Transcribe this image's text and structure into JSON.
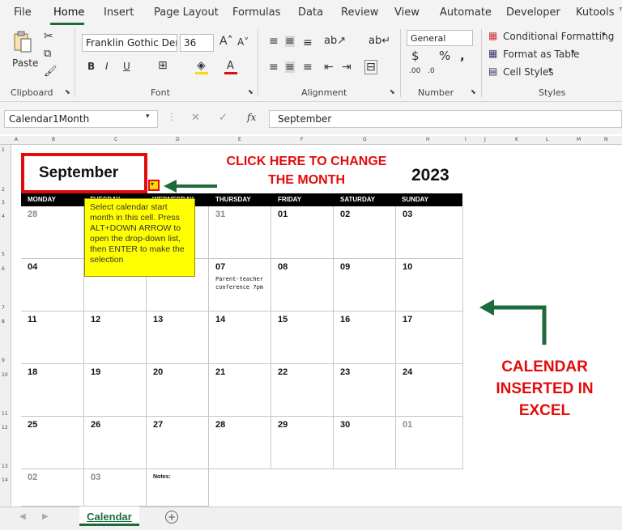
{
  "ribbon": {
    "tabs": [
      "File",
      "Home",
      "Insert",
      "Page Layout",
      "Formulas",
      "Data",
      "Review",
      "View",
      "Automate",
      "Developer",
      "Kutools ™"
    ],
    "active_tab": "Home",
    "clipboard": {
      "paste": "Paste",
      "label": "Clipboard"
    },
    "font": {
      "name": "Franklin Gothic Der",
      "size": "36",
      "label": "Font"
    },
    "alignment": {
      "label": "Alignment"
    },
    "number": {
      "format": "General",
      "label": "Number"
    },
    "styles": {
      "conditional": "Conditional Formatting",
      "format_table": "Format as Table",
      "cell_styles": "Cell Styles",
      "label": "Styles"
    }
  },
  "formula_bar": {
    "name_box": "Calendar1Month",
    "value": "September",
    "fx": "fx"
  },
  "columns": [
    "A",
    "B",
    "C",
    "D",
    "E",
    "F",
    "G",
    "H",
    "I",
    "J",
    "K",
    "L",
    "M",
    "N"
  ],
  "rows": [
    "1",
    "2",
    "3",
    "4",
    "5",
    "6",
    "7",
    "8",
    "9",
    "10",
    "11",
    "12",
    "13",
    "14"
  ],
  "calendar": {
    "month": "September",
    "year": "2023",
    "weekdays": [
      "MONDAY",
      "TUESDAY",
      "WEDNESDAY",
      "THURSDAY",
      "FRIDAY",
      "SATURDAY",
      "SUNDAY"
    ],
    "weeks": [
      [
        {
          "d": "28",
          "dim": true
        },
        {
          "d": "",
          "dim": false
        },
        {
          "d": "",
          "dim": false
        },
        {
          "d": "31",
          "dim": true
        },
        {
          "d": "01"
        },
        {
          "d": "02"
        },
        {
          "d": "03"
        }
      ],
      [
        {
          "d": "04"
        },
        {
          "d": ""
        },
        {
          "d": ""
        },
        {
          "d": "07",
          "note": "Parent-teacher conference 7pm"
        },
        {
          "d": "08"
        },
        {
          "d": "09"
        },
        {
          "d": "10"
        }
      ],
      [
        {
          "d": "11"
        },
        {
          "d": "12"
        },
        {
          "d": "13"
        },
        {
          "d": "14"
        },
        {
          "d": "15"
        },
        {
          "d": "16"
        },
        {
          "d": "17"
        }
      ],
      [
        {
          "d": "18"
        },
        {
          "d": "19"
        },
        {
          "d": "20"
        },
        {
          "d": "21"
        },
        {
          "d": "22"
        },
        {
          "d": "23"
        },
        {
          "d": "24"
        }
      ],
      [
        {
          "d": "25"
        },
        {
          "d": "26"
        },
        {
          "d": "27"
        },
        {
          "d": "28"
        },
        {
          "d": "29"
        },
        {
          "d": "30"
        },
        {
          "d": "01",
          "dim": true
        }
      ],
      [
        {
          "d": "02",
          "dim": true
        },
        {
          "d": "03",
          "dim": true
        },
        {
          "d": "Notes:",
          "notes": true
        }
      ]
    ],
    "tooltip": "Select calendar start month in this cell. Press ALT+DOWN ARROW to open the drop-down list, then ENTER to make the selection"
  },
  "annotations": {
    "click_here_1": "CLICK HERE TO CHANGE",
    "click_here_2": "THE MONTH",
    "inserted_1": "CALENDAR",
    "inserted_2": "INSERTED IN",
    "inserted_3": "EXCEL"
  },
  "sheets": {
    "active": "Calendar",
    "add": "+"
  },
  "colors": {
    "excel_green": "#1d6b3b",
    "annotation_red": "#e30b0b",
    "tooltip_yellow": "#ffff00",
    "header_black": "#000000"
  }
}
